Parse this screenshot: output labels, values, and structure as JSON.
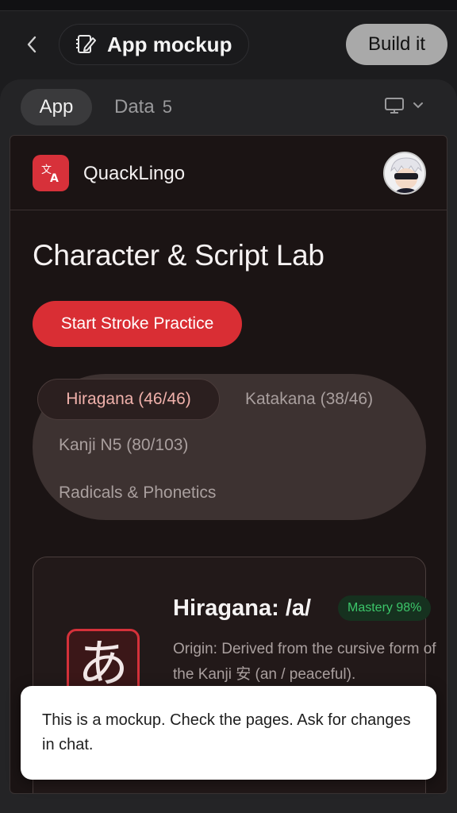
{
  "header": {
    "back_icon": "chevron-left-icon",
    "title_icon": "notebook-edit-icon",
    "title": "App mockup",
    "build_label": "Build it"
  },
  "tabs": {
    "app_label": "App",
    "data_label": "Data",
    "data_count": "5",
    "device_icon": "monitor-icon",
    "device_dropdown_icon": "chevron-down-icon"
  },
  "app": {
    "brand_name": "QuackLingo",
    "logo_icon": "translate-icon",
    "avatar": "user-avatar",
    "hero_title": "Character & Script Lab",
    "cta_label": "Start Stroke Practice",
    "scripts": [
      {
        "label": "Hiragana (46/46)",
        "active": true
      },
      {
        "label": "Katakana (38/46)",
        "active": false
      },
      {
        "label": "Kanji N5 (80/103)",
        "active": false
      },
      {
        "label": "Radicals & Phonetics",
        "active": false
      }
    ],
    "card": {
      "glyph": "あ",
      "title": "Hiragana: /a/",
      "mastery": "Mastery 98%",
      "origin": "Origin: Derived from the cursive form of the Kanji 安 (an / peaceful)."
    }
  },
  "toast": {
    "message": "This is a mockup. Check the pages. Ask for changes in chat."
  },
  "colors": {
    "accent": "#d92e34",
    "mastery_green": "#3cc66a",
    "active_chip_text": "#f0b1ab"
  }
}
